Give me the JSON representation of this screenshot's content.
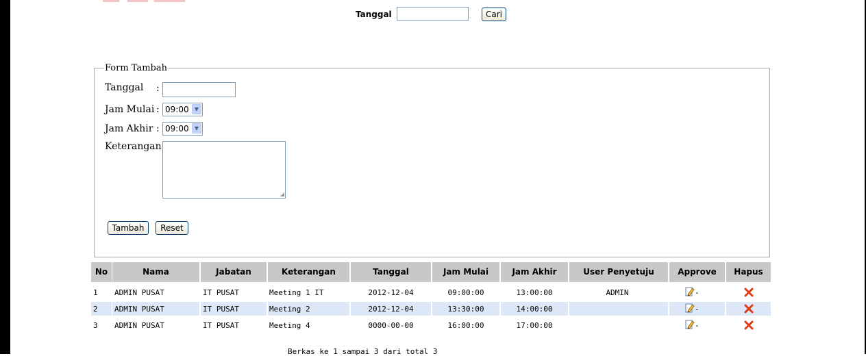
{
  "search": {
    "label": "Tanggal",
    "button": "Cari",
    "value": ""
  },
  "form": {
    "legend": "Form Tambah",
    "tanggal_label": "Tanggal",
    "jam_mulai_label": "Jam Mulai",
    "jam_akhir_label": "Jam Akhir",
    "keterangan_label": "Keterangan :",
    "colon": ":",
    "jam_mulai_value": "09:00",
    "jam_akhir_value": "09:00",
    "tambah_button": "Tambah",
    "reset_button": "Reset"
  },
  "table": {
    "headers": [
      "No",
      "Nama",
      "Jabatan",
      "Keterangan",
      "Tanggal",
      "Jam Mulai",
      "Jam Akhir",
      "User Penyetuju",
      "Approve",
      "Hapus"
    ],
    "rows": [
      {
        "no": "1",
        "nama": "ADMIN PUSAT",
        "jabatan": "IT PUSAT",
        "keterangan": "Meeting 1 IT",
        "tanggal": "2012-12-04",
        "jam_mulai": "09:00:00",
        "jam_akhir": "13:00:00",
        "user_penyetuju": "ADMIN"
      },
      {
        "no": "2",
        "nama": "ADMIN PUSAT",
        "jabatan": "IT PUSAT",
        "keterangan": "Meeting 2",
        "tanggal": "2012-12-04",
        "jam_mulai": "13:30:00",
        "jam_akhir": "14:00:00",
        "user_penyetuju": ""
      },
      {
        "no": "3",
        "nama": "ADMIN PUSAT",
        "jabatan": "IT PUSAT",
        "keterangan": "Meeting 4",
        "tanggal": "0000-00-00",
        "jam_mulai": "16:00:00",
        "jam_akhir": "17:00:00",
        "user_penyetuju": ""
      }
    ],
    "approve_icon": "edit-pencil-icon",
    "hapus_icon": "delete-x-icon"
  },
  "footer": {
    "pagination_text": "Berkas ke 1 sampai 3 dari total 3"
  },
  "colors": {
    "header_bg": "#c8c8c8",
    "row_highlight": "#dce8f7",
    "delete_red": "#e03a14"
  }
}
